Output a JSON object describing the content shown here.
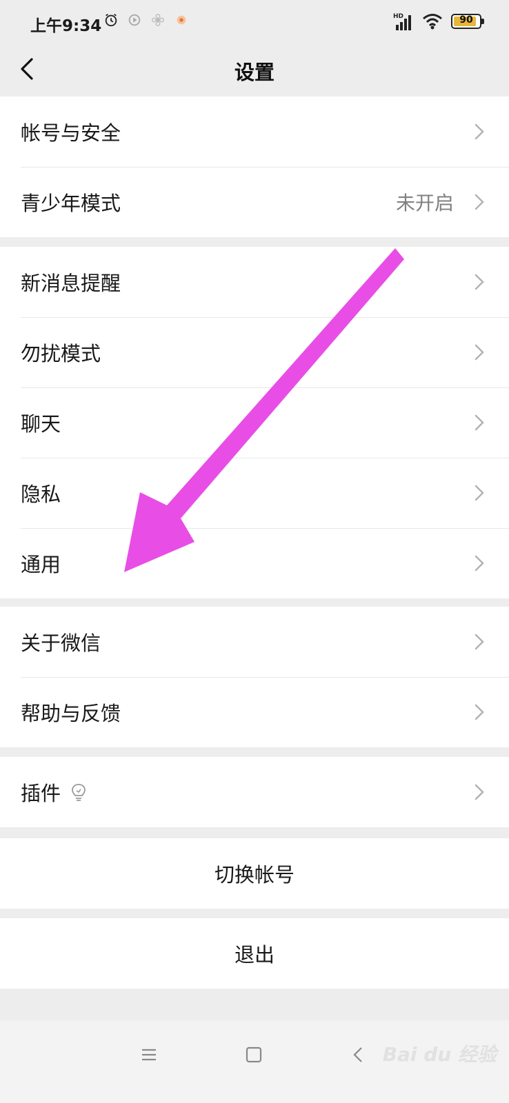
{
  "status_bar": {
    "time": "上午9:34",
    "network": "HD",
    "battery": "90",
    "battery_level": 0.9
  },
  "header": {
    "title": "设置",
    "back_icon": "chevron-left-icon"
  },
  "groups": [
    {
      "items": [
        {
          "label": "帐号与安全",
          "value": ""
        },
        {
          "label": "青少年模式",
          "value": "未开启"
        }
      ]
    },
    {
      "items": [
        {
          "label": "新消息提醒"
        },
        {
          "label": "勿扰模式"
        },
        {
          "label": "聊天"
        },
        {
          "label": "隐私"
        },
        {
          "label": "通用"
        }
      ]
    },
    {
      "items": [
        {
          "label": "关于微信"
        },
        {
          "label": "帮助与反馈"
        }
      ]
    },
    {
      "items": [
        {
          "label": "插件",
          "icon": "lightbulb-icon"
        }
      ]
    }
  ],
  "actions": {
    "switch_account": "切换帐号",
    "logout": "退出"
  },
  "system_nav": {
    "menu_icon": "menu-icon",
    "home_icon": "home-square-icon",
    "back_icon": "back-triangle-icon"
  },
  "watermark": {
    "text": "Bai du 经验"
  },
  "colors": {
    "background": "#ededed",
    "annotation_arrow": "#e84ee6"
  }
}
